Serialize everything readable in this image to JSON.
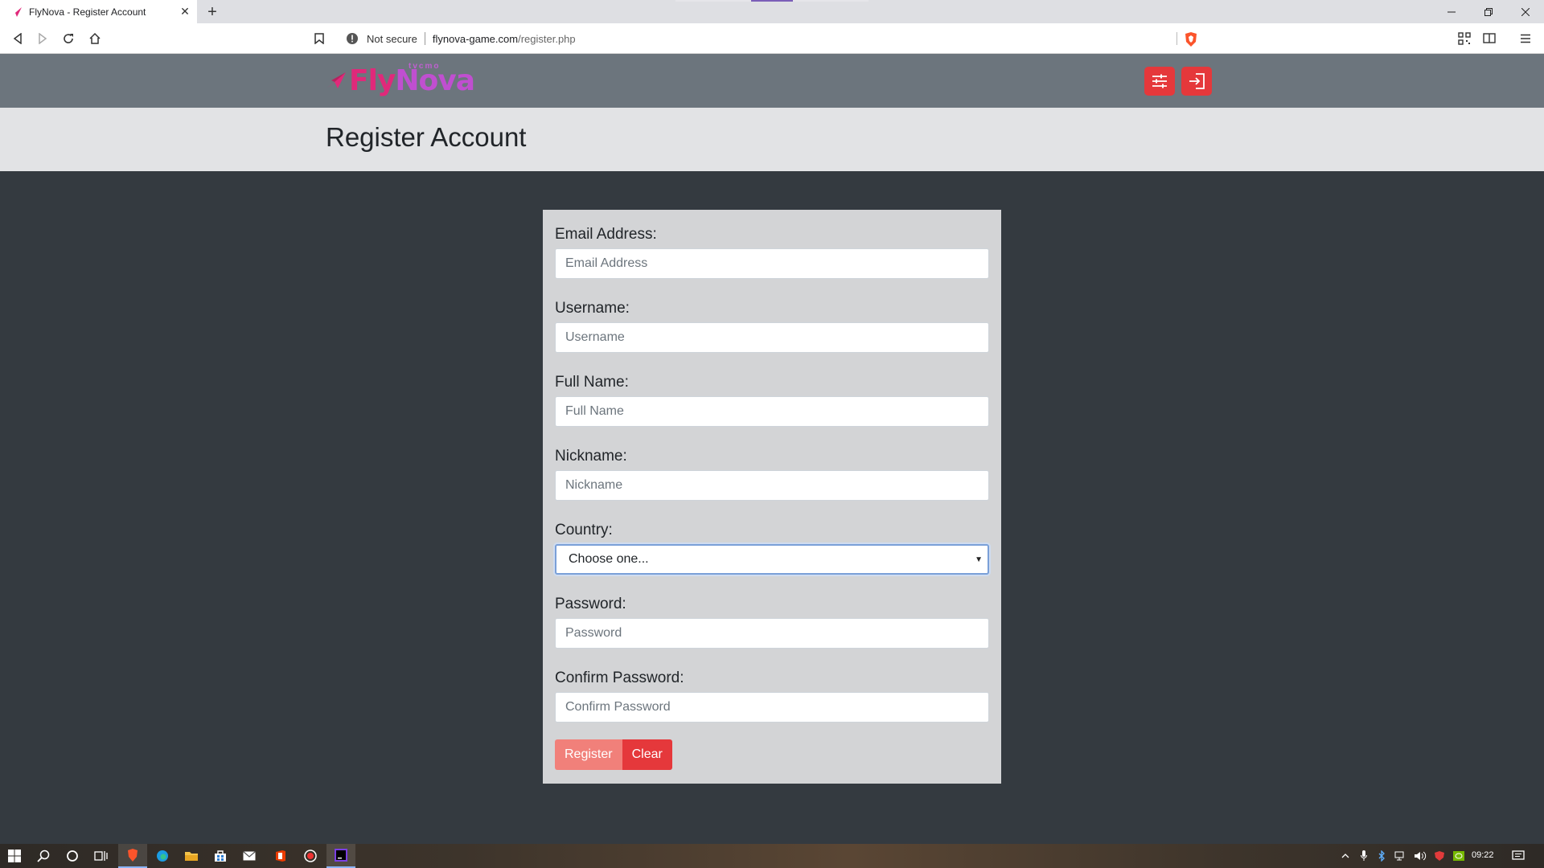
{
  "browser": {
    "tab_title": "FlyNova - Register Account",
    "tab_close": "✕",
    "new_tab": "+",
    "security_label": "Not secure",
    "url_host": "flynova-game.com",
    "url_path": "/register.php"
  },
  "site": {
    "logo_fly": "Fly",
    "logo_nova": "Nova",
    "logo_sub": "tvcmo"
  },
  "page": {
    "title": "Register Account"
  },
  "form": {
    "email_label": "Email Address:",
    "email_placeholder": "Email Address",
    "username_label": "Username:",
    "username_placeholder": "Username",
    "fullname_label": "Full Name:",
    "fullname_placeholder": "Full Name",
    "nickname_label": "Nickname:",
    "nickname_placeholder": "Nickname",
    "country_label": "Country:",
    "country_selected": "Choose one...",
    "password_label": "Password:",
    "password_placeholder": "Password",
    "confirm_label": "Confirm Password:",
    "confirm_placeholder": "Confirm Password",
    "register_button": "Register",
    "clear_button": "Clear"
  },
  "taskbar": {
    "clock": "09:22"
  },
  "colors": {
    "accent_red": "#e5383b",
    "register_salmon": "#f1807a",
    "header_gray": "#6c757d",
    "page_dark": "#343a40"
  }
}
